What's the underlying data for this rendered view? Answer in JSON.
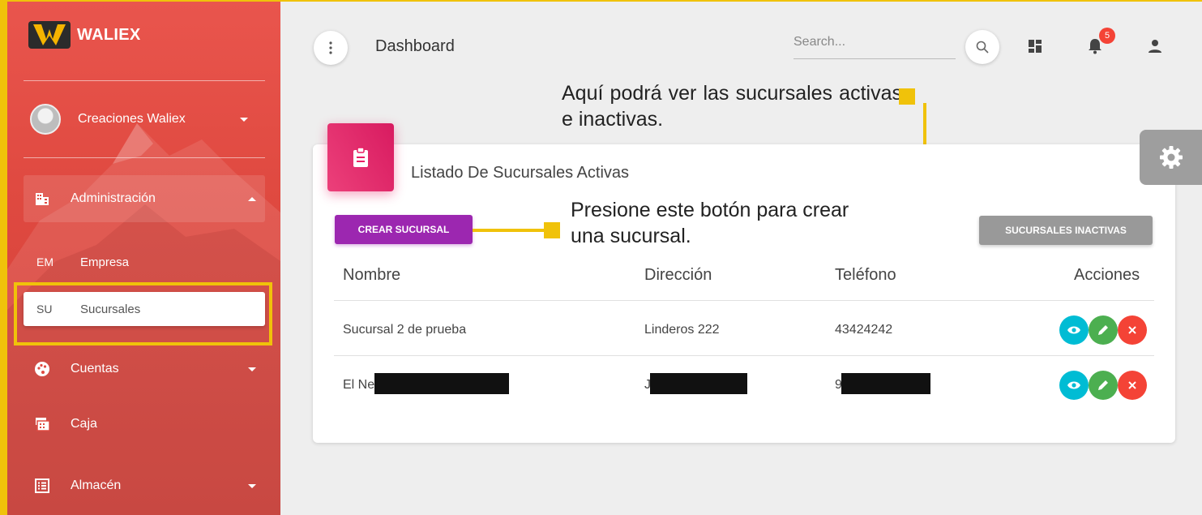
{
  "sidebar": {
    "brand": "WALIEX",
    "user_name": "Creaciones Waliex",
    "items": [
      {
        "label": "Administración",
        "icon": "building-icon"
      },
      {
        "abbr": "EM",
        "label": "Empresa"
      },
      {
        "abbr": "SU",
        "label": "Sucursales"
      },
      {
        "label": "Cuentas",
        "icon": "palette-icon"
      },
      {
        "label": "Caja",
        "icon": "cash-register-icon"
      },
      {
        "label": "Almacén",
        "icon": "list-box-icon"
      }
    ]
  },
  "header": {
    "title": "Dashboard",
    "search_placeholder": "Search...",
    "notifications_count": "5"
  },
  "callouts": {
    "top": "Aquí podrá ver las sucursales activas e inactivas.",
    "create": "Presione este botón para crear una sucursal."
  },
  "card": {
    "title": "Listado De Sucursales Activas",
    "create_button": "CREAR SUCURSAL",
    "inactive_button": "SUCURSALES INACTIVAS",
    "columns": [
      "Nombre",
      "Dirección",
      "Teléfono",
      "Acciones"
    ],
    "rows": [
      {
        "nombre": "Sucursal 2 de prueba",
        "direccion": "Linderos 222",
        "telefono": "43424242"
      },
      {
        "nombre": "El Ne",
        "direccion": "J",
        "telefono": "9"
      }
    ]
  },
  "colors": {
    "sidebar": "#e04a41",
    "highlight": "#f0c20a",
    "create_button": "#9c27b0",
    "card_icon": "#e91e63"
  }
}
